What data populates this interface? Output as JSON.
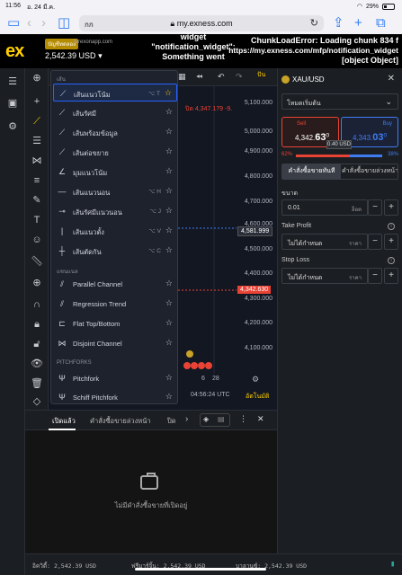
{
  "status": {
    "time": "11:56",
    "date": "อ. 24 มี.ค.",
    "battery": "29%"
  },
  "browser": {
    "aa": "กก",
    "url": "my.exness.com",
    "lock_icon": "lock-icon"
  },
  "header": {
    "demo_badge": "บัญชีทดลอง",
    "server": "forexonapp.com",
    "balance": "2,542.39 USD",
    "error_left_line1": "widget",
    "error_left_line2": "\"notification_widget\":",
    "error_left_line3": "Something went",
    "error_right_line1": "ChunkLoadError: Loading chunk 834 f",
    "error_right_line2": "https://my.exness.com/mfp/notification_widget",
    "error_right_line3": "[object Object]"
  },
  "chart": {
    "top_right_label": "ปัน",
    "prices": [
      "5,100.000",
      "5,000.000",
      "4,900.000",
      "4,800.000",
      "4,700.000",
      "4,600.000",
      "4,500.000",
      "4,400.000",
      "4,300.000",
      "4,200.000",
      "4,100.000"
    ],
    "tag_mid": "4,581.999",
    "tag_red": "4,342.630",
    "red_label": "ปิด 4,347.179 -9.",
    "date_tick_a": "6",
    "date_tick_b": "28",
    "time": "04:56:24 UTC",
    "auto_label": "อัตโนมัติ"
  },
  "dropdown": {
    "section1": "เส้น",
    "lines": [
      {
        "label": "เส้นแนวโน้ม",
        "shortcut": "⌥ T"
      },
      {
        "label": "เส้นรัศมี",
        "shortcut": ""
      },
      {
        "label": "เส้นพร้อมข้อมูล",
        "shortcut": ""
      },
      {
        "label": "เส้นต่อขยาย",
        "shortcut": ""
      },
      {
        "label": "มุมแนวโน้ม",
        "shortcut": ""
      },
      {
        "label": "เส้นแนวนอน",
        "shortcut": "⌥ H"
      },
      {
        "label": "เส้นรัศมีแนวนอน",
        "shortcut": "⌥ J"
      },
      {
        "label": "เส้นแนวตั้ง",
        "shortcut": "⌥ V"
      },
      {
        "label": "เส้นตัดกัน",
        "shortcut": "⌥ C"
      }
    ],
    "section2": "แชนแนล",
    "channels": [
      {
        "label": "Parallel Channel"
      },
      {
        "label": "Regression Trend"
      },
      {
        "label": "Flat Top/Bottom"
      },
      {
        "label": "Disjoint Channel"
      }
    ],
    "section3": "PITCHFORKS",
    "pitchforks": [
      {
        "label": "Pitchfork"
      },
      {
        "label": "Schiff Pitchfork"
      }
    ]
  },
  "panel": {
    "symbol": "XAU/USD",
    "mode": "โหมดเริ่มต้น",
    "sell_label": "Sell",
    "sell_price_main": "4,342",
    "sell_price_big": "63",
    "sell_price_sup": "0",
    "buy_label": "Buy",
    "buy_price_main": "4,343",
    "buy_price_big": "03",
    "buy_price_sup": "0",
    "spread": "0.40 USD",
    "sell_pct": "62%",
    "buy_pct": "38%",
    "order_market": "คำสั่งซื้อขายทันที",
    "order_pending": "คำสั่งซื้อขายล่วงหน้า",
    "volume_label": "ขนาด",
    "volume_value": "0.01",
    "volume_unit": "ล็อต",
    "tp_label": "Take Profit",
    "tp_value": "ไม่ได้กำหนด",
    "tp_unit": "ราคา",
    "sl_label": "Stop Loss",
    "sl_value": "ไม่ได้กำหนด",
    "sl_unit": "ราคา"
  },
  "positions": {
    "tab_open": "เปิดแล้ว",
    "tab_pending": "คำสั่งซื้อขายล่วงหน้า",
    "tab_closed": "ปิด",
    "empty_text": "ไม่มีคำสั่งซื้อขายที่เปิดอยู่"
  },
  "bottom": {
    "equity": "อิควิตี้: 2,542.39 USD",
    "free_margin": "ฟรีมาร์จิ้น: 2,542.39 USD",
    "balance": "บาลานซ์: 2,542.39 USD"
  },
  "colors": {
    "brand": "#ffcf01",
    "sell": "#e94335",
    "buy": "#3f7cf2"
  }
}
